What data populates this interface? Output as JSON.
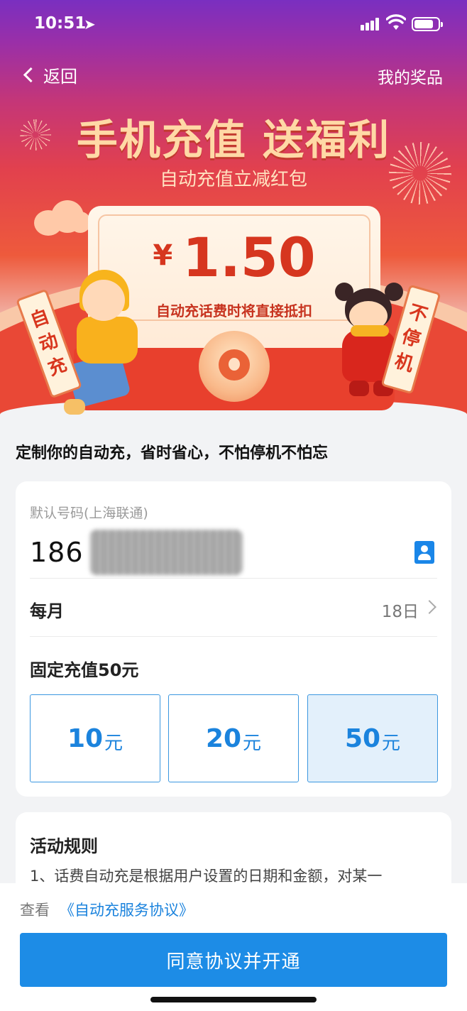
{
  "status_bar": {
    "time": "10:51"
  },
  "nav": {
    "back_label": "返回",
    "prizes_label": "我的奖品"
  },
  "banner": {
    "headline": "手机充值 送福利",
    "subhead": "自动充值立减红包",
    "currency": "¥",
    "amount": "1.50",
    "note": "自动充话费时将直接抵扣",
    "scroll_left": "自动充",
    "scroll_right": "不停机"
  },
  "intro": "定制你的自动充，省时省心，不怕停机不怕忘",
  "form": {
    "number_label": "默认号码(上海联通)",
    "phone_prefix": "186",
    "frequency_label": "每月",
    "day_value": "18日",
    "fixed_label": "固定充值50元",
    "amounts": [
      {
        "value": "10",
        "unit": "元",
        "selected": false
      },
      {
        "value": "20",
        "unit": "元",
        "selected": false
      },
      {
        "value": "50",
        "unit": "元",
        "selected": true
      }
    ]
  },
  "rules": {
    "title": "活动规则",
    "text": "1、话费自动充是根据用户设置的日期和金额，对某一"
  },
  "footer": {
    "agree_prefix": "查看",
    "agreement_link": "《自动充服务协议》",
    "cta_label": "同意协议并开通"
  },
  "colors": {
    "accent": "#1d8ce6",
    "banner_red": "#e94836",
    "price_red": "#d6361f"
  }
}
